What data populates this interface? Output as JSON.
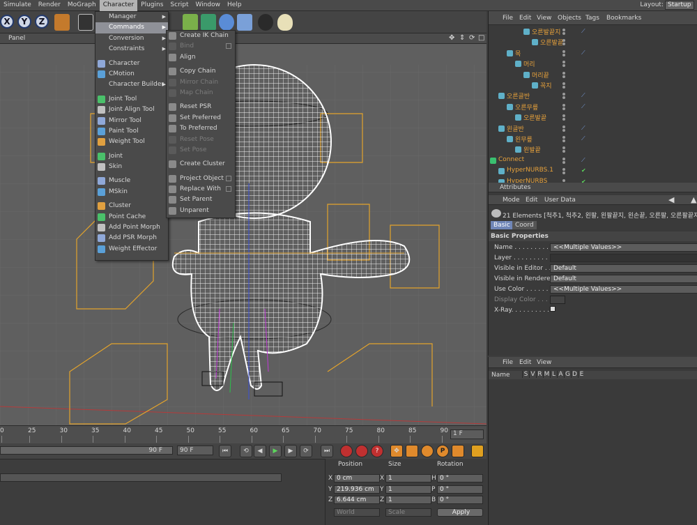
{
  "menubar": {
    "items": [
      "Simulate",
      "Render",
      "MoGraph",
      "Character",
      "Plugins",
      "Script",
      "Window",
      "Help"
    ],
    "active": "Character",
    "layout_label": "Layout:",
    "layout_value": "Startup"
  },
  "viewport": {
    "panel_label": "Panel"
  },
  "character_menu": [
    {
      "label": "Manager",
      "submenu": true
    },
    {
      "label": "Commands",
      "submenu": true,
      "highlighted": true
    },
    {
      "label": "Conversion",
      "submenu": true
    },
    {
      "label": "Constraints",
      "submenu": true
    },
    {
      "label": "Character",
      "icon": "character-icon"
    },
    {
      "label": "CMotion",
      "icon": "cmotion-icon"
    },
    {
      "label": "Character Builder",
      "submenu": true
    },
    {
      "label": "Joint Tool",
      "icon": "joint-tool-icon"
    },
    {
      "label": "Joint Align Tool",
      "icon": "joint-align-icon"
    },
    {
      "label": "Mirror Tool",
      "icon": "mirror-tool-icon"
    },
    {
      "label": "Paint Tool",
      "icon": "paint-tool-icon"
    },
    {
      "label": "Weight Tool",
      "icon": "weight-tool-icon"
    },
    {
      "label": "Joint",
      "icon": "joint-icon"
    },
    {
      "label": "Skin",
      "icon": "skin-icon"
    },
    {
      "label": "Muscle",
      "icon": "muscle-icon"
    },
    {
      "label": "MSkin",
      "icon": "mskin-icon"
    },
    {
      "label": "Cluster",
      "icon": "cluster-icon"
    },
    {
      "label": "Point Cache",
      "icon": "point-cache-icon"
    },
    {
      "label": "Add Point Morph",
      "icon": "point-morph-icon"
    },
    {
      "label": "Add PSR Morph",
      "icon": "psr-morph-icon"
    },
    {
      "label": "Weight Effector",
      "icon": "weight-effector-icon"
    }
  ],
  "commands_menu": [
    {
      "label": "Create IK Chain",
      "disabled": false
    },
    {
      "label": "Bind",
      "disabled": true
    },
    {
      "label": "Align",
      "disabled": false
    },
    {
      "label": "Copy Chain",
      "disabled": false
    },
    {
      "label": "Mirror Chain",
      "disabled": true
    },
    {
      "label": "Map Chain",
      "disabled": true
    },
    {
      "label": "Reset PSR",
      "disabled": false
    },
    {
      "label": "Set Preferred",
      "disabled": false
    },
    {
      "label": "To Preferred",
      "disabled": false
    },
    {
      "label": "Reset Pose",
      "disabled": true
    },
    {
      "label": "Set Pose",
      "disabled": true
    },
    {
      "label": "Create Cluster",
      "disabled": false
    },
    {
      "label": "Project Object",
      "disabled": false
    },
    {
      "label": "Replace With",
      "disabled": false
    },
    {
      "label": "Set Parent",
      "disabled": false
    },
    {
      "label": "Unparent",
      "disabled": false
    }
  ],
  "object_manager": {
    "menu": [
      "File",
      "Edit",
      "View",
      "Objects",
      "Tags",
      "Bookmarks"
    ],
    "rows": [
      {
        "name": "오른발끝지",
        "indent": 3
      },
      {
        "name": "오른발끝",
        "indent": 4
      },
      {
        "name": "목",
        "indent": 1
      },
      {
        "name": "머리",
        "indent": 2
      },
      {
        "name": "머리끝",
        "indent": 3
      },
      {
        "name": "꼭지",
        "indent": 4
      },
      {
        "name": "오른골반",
        "indent": 0
      },
      {
        "name": "오른무릎",
        "indent": 1
      },
      {
        "name": "오른발끝",
        "indent": 2
      },
      {
        "name": "왼골반",
        "indent": 0
      },
      {
        "name": "왼무릎",
        "indent": 1
      },
      {
        "name": "왼발끝",
        "indent": 2
      },
      {
        "name": "Connect",
        "indent": -1
      },
      {
        "name": "HyperNURBS.1",
        "indent": 0
      },
      {
        "name": "HyperNURBS",
        "indent": 0
      }
    ]
  },
  "attributes": {
    "title": "Attributes",
    "menu": [
      "Mode",
      "Edit",
      "User Data"
    ],
    "selection": "21 Elements [척추1, 척추2, 왼팔, 왼팔끝지, 왼손끝, 오른팔, 오른팔끝지, 오",
    "tabs": [
      "Basic",
      "Coord"
    ],
    "section": "Basic Properties",
    "fields": [
      {
        "label": "Name . . . . . . . . . . .",
        "value": "<<Multiple Values>>"
      },
      {
        "label": "Layer . . . . . . . . . .",
        "value": ""
      },
      {
        "label": "Visible in Editor . .",
        "value": "Default"
      },
      {
        "label": "Visible in Renderer",
        "value": "Default"
      },
      {
        "label": "Use Color . . . . . . .",
        "value": "<<Multiple Values>>"
      },
      {
        "label": "Display Color . . .",
        "value": ""
      },
      {
        "label": "X-Ray. . . . . . . . . . .",
        "value": ""
      }
    ]
  },
  "layers": {
    "menu": [
      "File",
      "Edit",
      "View"
    ],
    "header": "Name",
    "flags": [
      "S",
      "V",
      "R",
      "M",
      "L",
      "A",
      "G",
      "D",
      "E"
    ]
  },
  "timeline": {
    "ticks": [
      "0",
      "25",
      "30",
      "35",
      "40",
      "45",
      "50",
      "55",
      "60",
      "65",
      "70",
      "75",
      "80",
      "85",
      "90"
    ],
    "frame_field": "1 F",
    "end_frame_a": "90 F",
    "end_frame_b": "90 F"
  },
  "coordinates": {
    "headers": [
      "Position",
      "Size",
      "Rotation"
    ],
    "rows": [
      {
        "pos_axis": "X",
        "pos": "0 cm",
        "size_axis": "X",
        "size": "1",
        "rot_axis": "H",
        "rot": "0 °"
      },
      {
        "pos_axis": "Y",
        "pos": "219.936 cm",
        "size_axis": "Y",
        "size": "1",
        "rot_axis": "P",
        "rot": "0 °"
      },
      {
        "pos_axis": "Z",
        "pos": "6.644 cm",
        "size_axis": "Z",
        "size": "1",
        "rot_axis": "B",
        "rot": "0 °"
      }
    ],
    "mode_world": "World",
    "mode_scale": "Scale",
    "apply": "Apply"
  }
}
